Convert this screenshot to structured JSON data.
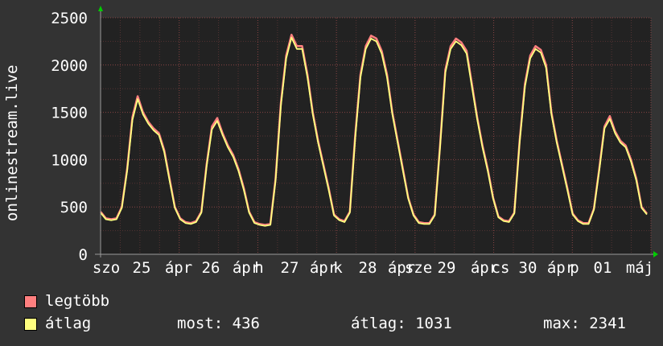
{
  "chart_data": {
    "type": "line",
    "ylabel": "onlinestream.live",
    "ylim": [
      0,
      2500
    ],
    "yticks": [
      0,
      500,
      1000,
      1500,
      2000,
      2500
    ],
    "grid": true,
    "x_tick_labels": [
      "szo",
      "25",
      "ápr",
      "26",
      "ápr",
      "h",
      "27",
      "ápr",
      "k",
      "28",
      "ápr",
      "sze",
      "29",
      "ápr",
      "cs",
      "30",
      "ápr",
      "p",
      "01",
      "máj"
    ],
    "series": [
      {
        "name": "legtöbb",
        "color": "#ff7f7f",
        "values": [
          450,
          380,
          370,
          380,
          500,
          900,
          1450,
          1670,
          1500,
          1400,
          1330,
          1280,
          1100,
          800,
          500,
          380,
          340,
          330,
          350,
          450,
          950,
          1350,
          1440,
          1280,
          1150,
          1050,
          900,
          700,
          450,
          340,
          320,
          310,
          320,
          800,
          1600,
          2100,
          2320,
          2200,
          2200,
          1900,
          1500,
          1200,
          950,
          700,
          420,
          370,
          350,
          450,
          1250,
          1900,
          2200,
          2310,
          2280,
          2150,
          1900,
          1500,
          1200,
          900,
          600,
          420,
          340,
          330,
          330,
          420,
          1150,
          1950,
          2200,
          2280,
          2240,
          2150,
          1800,
          1450,
          1150,
          900,
          600,
          400,
          360,
          350,
          440,
          1200,
          1800,
          2100,
          2200,
          2160,
          2000,
          1500,
          1200,
          950,
          700,
          430,
          360,
          330,
          330,
          480,
          900,
          1350,
          1460,
          1300,
          1200,
          1150,
          1000,
          800,
          500,
          430
        ],
        "color_value": "#ff7f7f"
      },
      {
        "name": "átlag",
        "color": "#ffff7f",
        "values": [
          440,
          370,
          360,
          370,
          490,
          880,
          1420,
          1640,
          1480,
          1380,
          1310,
          1260,
          1080,
          780,
          490,
          370,
          330,
          320,
          340,
          440,
          930,
          1320,
          1410,
          1260,
          1130,
          1030,
          880,
          680,
          440,
          330,
          310,
          300,
          310,
          780,
          1570,
          2070,
          2290,
          2170,
          2170,
          1870,
          1480,
          1180,
          930,
          680,
          410,
          360,
          340,
          440,
          1220,
          1870,
          2170,
          2280,
          2250,
          2120,
          1870,
          1480,
          1180,
          880,
          590,
          410,
          330,
          320,
          320,
          410,
          1130,
          1920,
          2170,
          2250,
          2210,
          2120,
          1770,
          1430,
          1130,
          880,
          590,
          390,
          350,
          340,
          430,
          1180,
          1770,
          2070,
          2170,
          2130,
          1970,
          1480,
          1180,
          930,
          680,
          420,
          350,
          320,
          320,
          470,
          880,
          1330,
          1430,
          1280,
          1180,
          1130,
          980,
          780,
          490,
          420
        ]
      }
    ],
    "legend": [
      {
        "label": "legtöbb",
        "color": "#ff7f7f"
      },
      {
        "label": "átlag",
        "color": "#ffff7f"
      }
    ],
    "stats": {
      "most": "most: 436",
      "atlag": "átlag: 1031",
      "max": "max: 2341"
    }
  }
}
